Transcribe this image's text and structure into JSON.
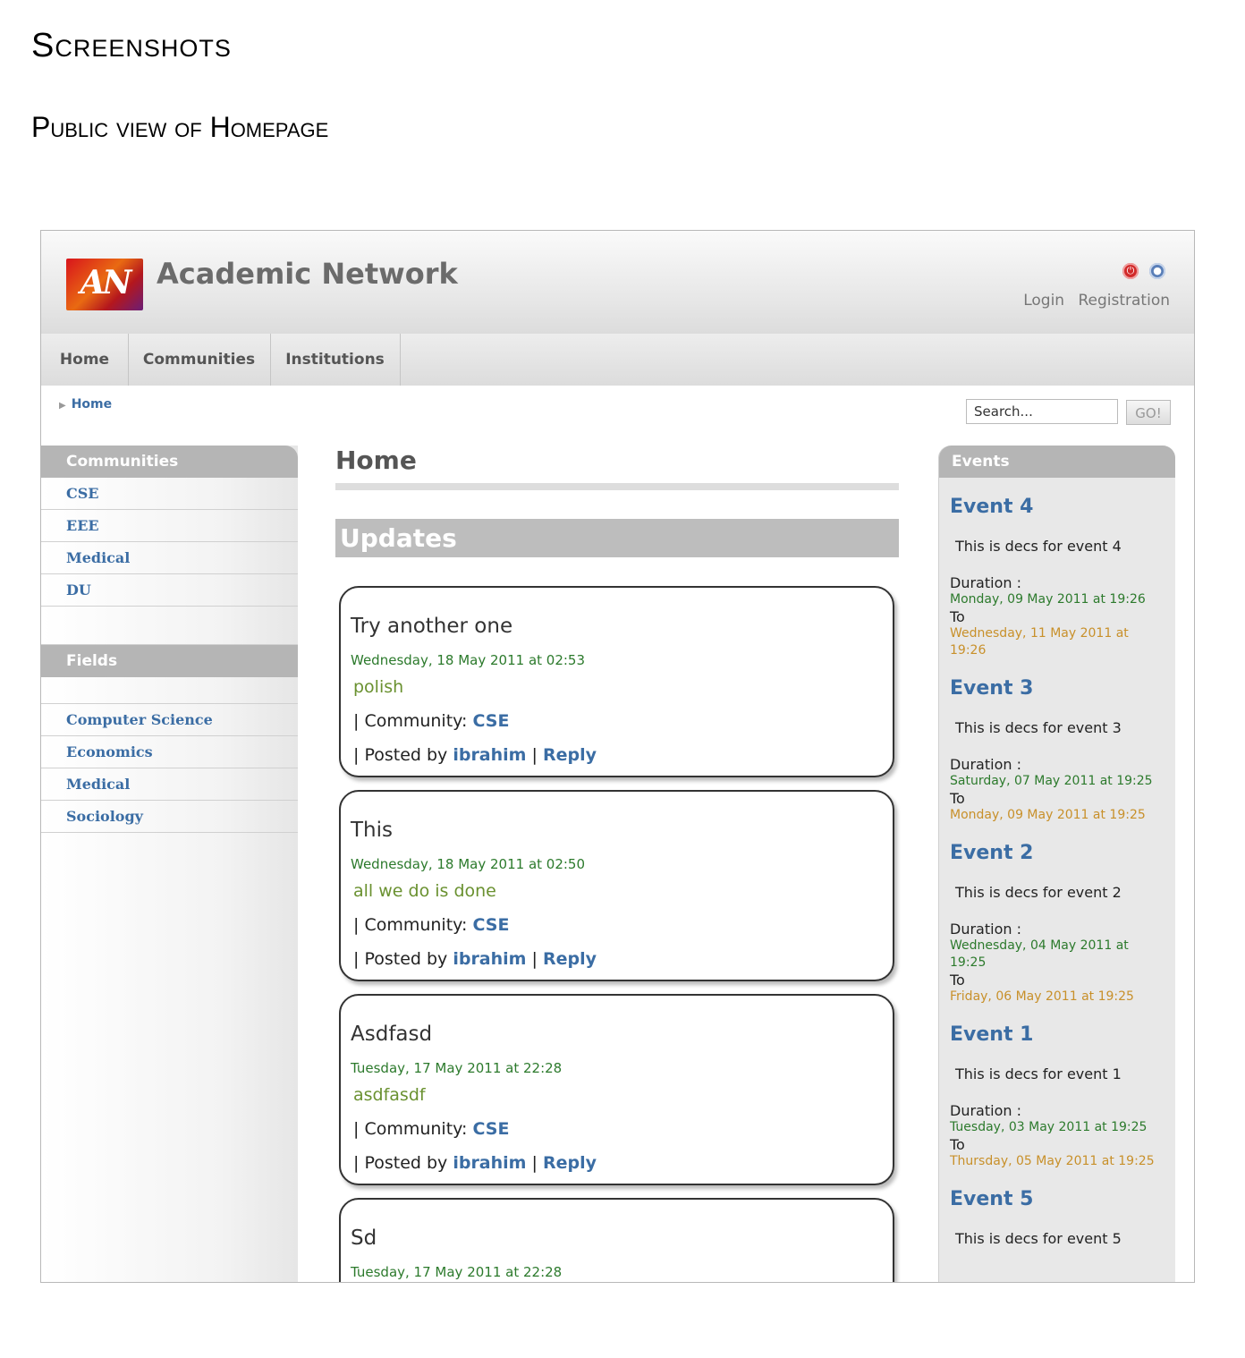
{
  "document": {
    "heading": "Screenshots",
    "subheading": "Public view of Homepage"
  },
  "header": {
    "logo_text": "AN",
    "title": "Academic Network",
    "links": [
      "Login",
      "Registration"
    ]
  },
  "nav": [
    "Home",
    "Communities",
    "Institutions"
  ],
  "breadcrumb": "Home",
  "search": {
    "value": "Search...",
    "button": "GO!"
  },
  "left_sidebar": {
    "communities_title": "Communities",
    "communities": [
      "CSE",
      "EEE",
      "Medical",
      "DU"
    ],
    "fields_title": "Fields",
    "fields": [
      "Computer Science",
      "Economics",
      "Medical",
      "Sociology"
    ]
  },
  "main": {
    "title": "Home",
    "section": "Updates",
    "posts": [
      {
        "title": "Try another one",
        "date": "Wednesday, 18 May 2011 at 02:53",
        "body": "polish",
        "community_label": "| Community: ",
        "community": "CSE",
        "posted_by_label": "| Posted by ",
        "author": "ibrahim",
        "sep": " | ",
        "reply": "Reply"
      },
      {
        "title": "This",
        "date": "Wednesday, 18 May 2011 at 02:50",
        "body": "all we do is done",
        "community_label": "| Community: ",
        "community": "CSE",
        "posted_by_label": "| Posted by ",
        "author": "ibrahim",
        "sep": " | ",
        "reply": "Reply"
      },
      {
        "title": "Asdfasd",
        "date": "Tuesday, 17 May 2011 at 22:28",
        "body": "asdfasdf",
        "community_label": "| Community: ",
        "community": "CSE",
        "posted_by_label": "| Posted by ",
        "author": "ibrahim",
        "sep": " | ",
        "reply": "Reply"
      },
      {
        "title": "Sd",
        "date": "Tuesday, 17 May 2011 at 22:28",
        "body": "",
        "community_label": "",
        "community": "",
        "posted_by_label": "",
        "author": "",
        "sep": "",
        "reply": ""
      }
    ]
  },
  "events": {
    "title": "Events",
    "items": [
      {
        "title": "Event 4",
        "desc": "This is decs for event 4",
        "duration": "Duration :",
        "from": "Monday, 09 May 2011 at 19:26",
        "to": "To",
        "until": "Wednesday, 11 May 2011 at 19:26"
      },
      {
        "title": "Event 3",
        "desc": "This is decs for event 3",
        "duration": "Duration :",
        "from": "Saturday, 07 May 2011 at 19:25",
        "to": "To",
        "until": "Monday, 09 May 2011 at 19:25"
      },
      {
        "title": "Event 2",
        "desc": "This is decs for event 2",
        "duration": "Duration :",
        "from": "Wednesday, 04 May 2011 at 19:25",
        "to": "To",
        "until": "Friday, 06 May 2011 at 19:25"
      },
      {
        "title": "Event 1",
        "desc": "This is decs for event 1",
        "duration": "Duration :",
        "from": "Tuesday, 03 May 2011 at 19:25",
        "to": "To",
        "until": "Thursday, 05 May 2011 at 19:25"
      },
      {
        "title": "Event 5",
        "desc": "This is decs for event 5",
        "duration": "",
        "from": "",
        "to": "",
        "until": ""
      }
    ]
  }
}
